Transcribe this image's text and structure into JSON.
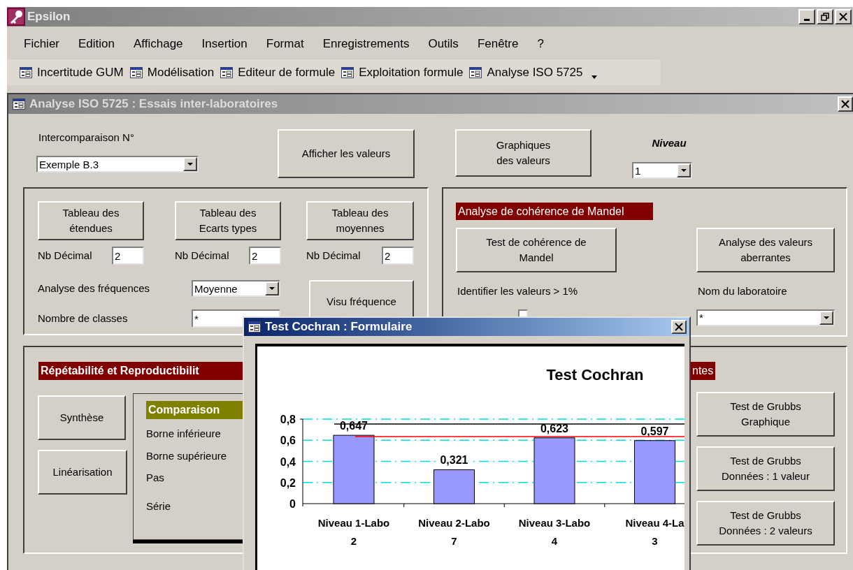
{
  "window": {
    "title": "Epsilon"
  },
  "menu": [
    {
      "label": "Fichier"
    },
    {
      "label": "Edition"
    },
    {
      "label": "Affichage"
    },
    {
      "label": "Insertion"
    },
    {
      "label": "Format"
    },
    {
      "label": "Enregistrements"
    },
    {
      "label": "Outils"
    },
    {
      "label": "Fenêtre"
    },
    {
      "label": "?"
    }
  ],
  "toolbar": [
    {
      "label": "Incertitude GUM"
    },
    {
      "label": "Modélisation"
    },
    {
      "label": "Editeur de formule"
    },
    {
      "label": "Exploitation formule"
    },
    {
      "label": "Analyse ISO 5725"
    }
  ],
  "form": {
    "title": "Analyse ISO 5725 : Essais inter-laboratoires",
    "intercomparaison": {
      "label": "Intercomparaison N°",
      "value": "Exemple B.3"
    },
    "show_values_button": "Afficher les valeurs",
    "graphs_button": "Graphiques\ndes valeurs",
    "niveau": {
      "label": "Niveau",
      "value": "1"
    },
    "tables": [
      {
        "button": "Tableau des\nétendues",
        "decimal_label": "Nb Décimal",
        "decimal_value": "2"
      },
      {
        "button": "Tableau des\nEcarts types",
        "decimal_label": "Nb Décimal",
        "decimal_value": "2"
      },
      {
        "button": "Tableau des\nmoyennes",
        "decimal_label": "Nb Décimal",
        "decimal_value": "2"
      }
    ],
    "frequency": {
      "label": "Analyse des fréquences",
      "value": "Moyenne",
      "button": "Visu fréquence"
    },
    "classes": {
      "label": "Nombre de classes",
      "value": "*"
    },
    "mandel": {
      "header": "Analyse de cohérence de Mandel",
      "test_button": "Test de cohérence de\nMandel",
      "outliers_button": "Analyse des valeurs\naberrantes",
      "identify_label": "Identifier les valeurs > 1%",
      "identify_checked": false,
      "lab_label": "Nom du laboratoire",
      "lab_value": "*"
    },
    "repeatability": {
      "header": "Répétabilité et Reproductibilit",
      "buttons": [
        "Synthèse",
        "Linéarisation"
      ],
      "comparison": {
        "header": "Comparaison",
        "labels": [
          "Borne inférieure",
          "Borne supérieure",
          "Pas",
          "Série"
        ]
      }
    },
    "outliers": {
      "header": "ntes",
      "buttons": [
        "Test de Grubbs\nGraphique",
        "Test de Grubbs\nDonnées : 1 valeur",
        "Test de Grubbs\nDonnées : 2 valeurs"
      ]
    }
  },
  "dialog": {
    "title": "Test Cochran : Formulaire",
    "chart_data": {
      "type": "bar",
      "title": "Test Cochran",
      "categories": [
        "Niveau 1-Labo 2",
        "Niveau 2-Labo 7",
        "Niveau 3-Labo 4",
        "Niveau 4-La 3"
      ],
      "values": [
        0.647,
        0.321,
        0.623,
        0.597
      ],
      "grid": true,
      "ylim": [
        0,
        0.8
      ],
      "yticks": [
        {
          "value": 0,
          "label": "0"
        },
        {
          "value": 0.2,
          "label": "0,2"
        },
        {
          "value": 0.4,
          "label": "0,4"
        },
        {
          "value": 0.6,
          "label": "0,6"
        },
        {
          "value": 0.8,
          "label": "0,8"
        }
      ],
      "value_labels": [
        "0,647",
        "0,321",
        "0,623",
        "0,597"
      ]
    }
  }
}
